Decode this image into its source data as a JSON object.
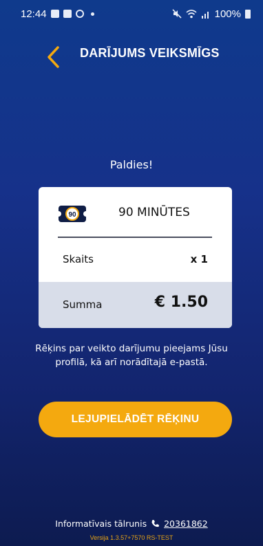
{
  "status_bar": {
    "time": "12:44",
    "battery": "100%",
    "icons": [
      "photo-icon",
      "video-icon",
      "settings-icon",
      "mute-icon",
      "wifi-icon",
      "signal-icon",
      "battery-icon"
    ]
  },
  "header": {
    "title": "DARĪJUMS VEIKSMĪGS",
    "back_icon": "chevron-left-icon"
  },
  "thanks_text": "Paldies!",
  "card": {
    "ticket_name": "90 MINŪTES",
    "ticket_icon_text": "90",
    "count_label": "Skaits",
    "count_value": "x 1",
    "sum_label": "Summa",
    "sum_value": "€ 1.50"
  },
  "notice": "Rēķins par veikto darījumu pieejams Jūsu profilā, kā arī norādītajā e-pastā.",
  "download_button": "LEJUPIELĀDĒT RĒĶINU",
  "footer": {
    "info_label": "Informatīvais tālrunis",
    "phone": "20361862",
    "version": "Versija 1.3.57+7570 RS-TEST"
  },
  "colors": {
    "accent": "#f4a90f",
    "background_top": "#0f3a8c",
    "background_bottom": "#0d1b50"
  }
}
